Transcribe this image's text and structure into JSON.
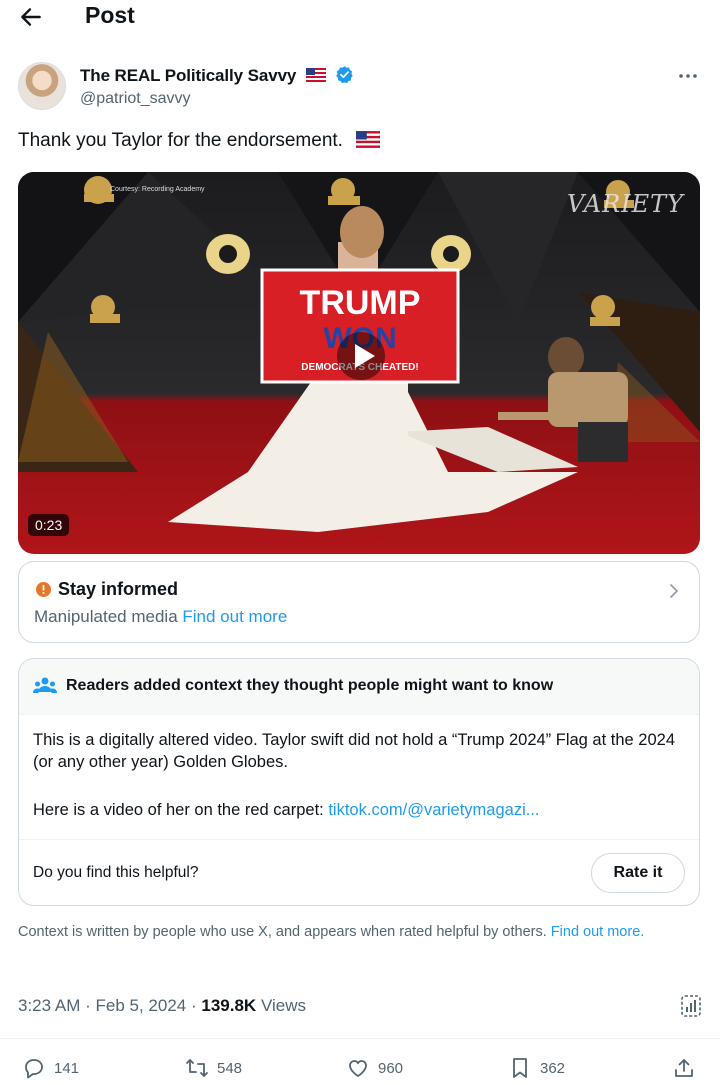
{
  "header": {
    "title": "Post"
  },
  "author": {
    "display_name": "The REAL Politically Savvy",
    "handle": "@patriot_savvy"
  },
  "post": {
    "text": "Thank you Taylor for the endorsement.",
    "video": {
      "duration": "0:23",
      "credit": "Courtesy: Recording Academy",
      "watermark": "VARIETY",
      "sign_text_1": "TRUMP",
      "sign_text_2": "WON",
      "sign_text_3": "DEMOCRATS CHEATED!"
    }
  },
  "stay_informed": {
    "title": "Stay informed",
    "label": "Manipulated media",
    "link": "Find out more"
  },
  "community_note": {
    "header": "Readers added context they thought people might want to know",
    "body": "This is a digitally altered video. Taylor swift did not hold a “Trump 2024” Flag at the 2024 (or any other year) Golden Globes.",
    "link_intro": "Here is a video of her on the red carpet:",
    "link_text": "tiktok.com/@varietymagazi...",
    "helpful_question": "Do you find this helpful?",
    "rate_label": "Rate it"
  },
  "context_note": {
    "text": "Context is written by people who use X, and appears when rated helpful by others.",
    "link": "Find out more."
  },
  "meta": {
    "time": "3:23 AM",
    "date": "Feb 5, 2024",
    "views_count": "139.8K",
    "views_label": "Views"
  },
  "actions": {
    "replies": "141",
    "reposts": "548",
    "likes": "960",
    "bookmarks": "362"
  },
  "colors": {
    "link": "#1d9bf0",
    "verified": "#1d9bf0",
    "secondary_text": "#536471",
    "warning": "#e6762b"
  },
  "icons": [
    "back-arrow-icon",
    "verified-badge-icon",
    "us-flag-icon",
    "more-icon",
    "play-icon",
    "warning-icon",
    "chevron-right-icon",
    "community-notes-icon",
    "analytics-icon",
    "reply-icon",
    "repost-icon",
    "like-icon",
    "bookmark-icon",
    "share-icon"
  ]
}
